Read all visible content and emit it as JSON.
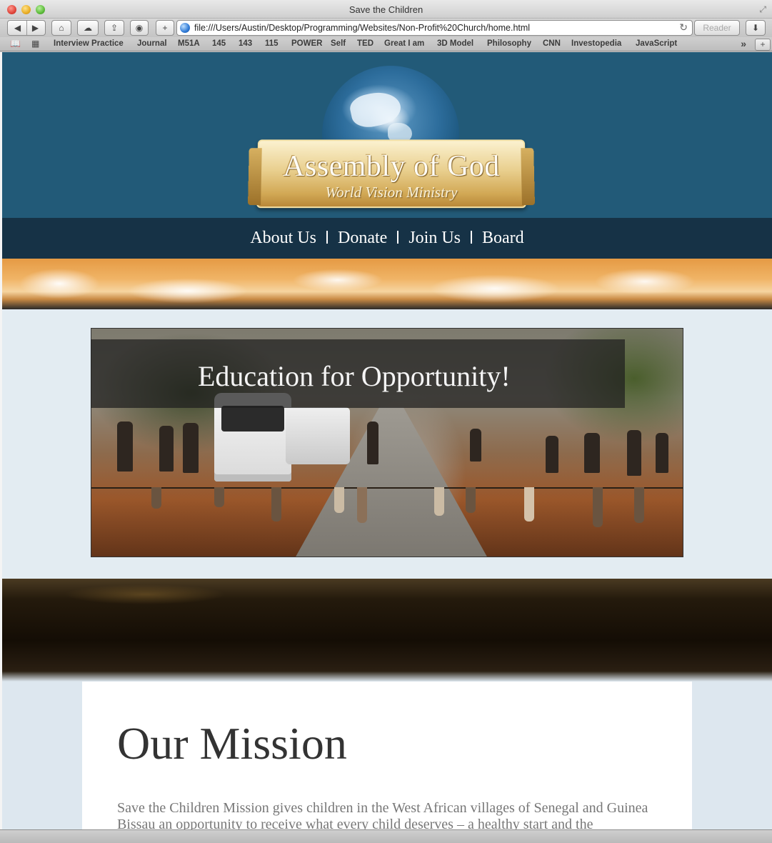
{
  "window": {
    "title": "Save the Children"
  },
  "toolbar": {
    "back_icon": "back-arrow-icon",
    "forward_icon": "forward-arrow-icon",
    "url": "file:///Users/Austin/Desktop/Programming/Websites/Non-Profit%20Church/home.html",
    "reader_label": "Reader"
  },
  "bookmarks": [
    "Interview Practice",
    "Journal",
    "M51A",
    "145",
    "143",
    "115",
    "POWER",
    "Self",
    "TED",
    "Great I am",
    "3D Model",
    "Philosophy",
    "CNN",
    "Investopedia",
    "JavaScript"
  ],
  "site": {
    "logo_title": "Assembly of God",
    "logo_subtitle": "World Vision Ministry",
    "nav": [
      "About Us",
      "Donate",
      "Join Us",
      "Board"
    ],
    "hero_heading": "Education for Opportunity!",
    "mission_title": "Our Mission",
    "mission_text": "Save the Children Mission gives children in the West African villages of Senegal and Guinea Bissau an opportunity to receive what every child deserves – a healthy start and the"
  },
  "colors": {
    "header_bg": "#225a78",
    "nav_bg": "#163246",
    "page_bg": "#dde7ef"
  }
}
